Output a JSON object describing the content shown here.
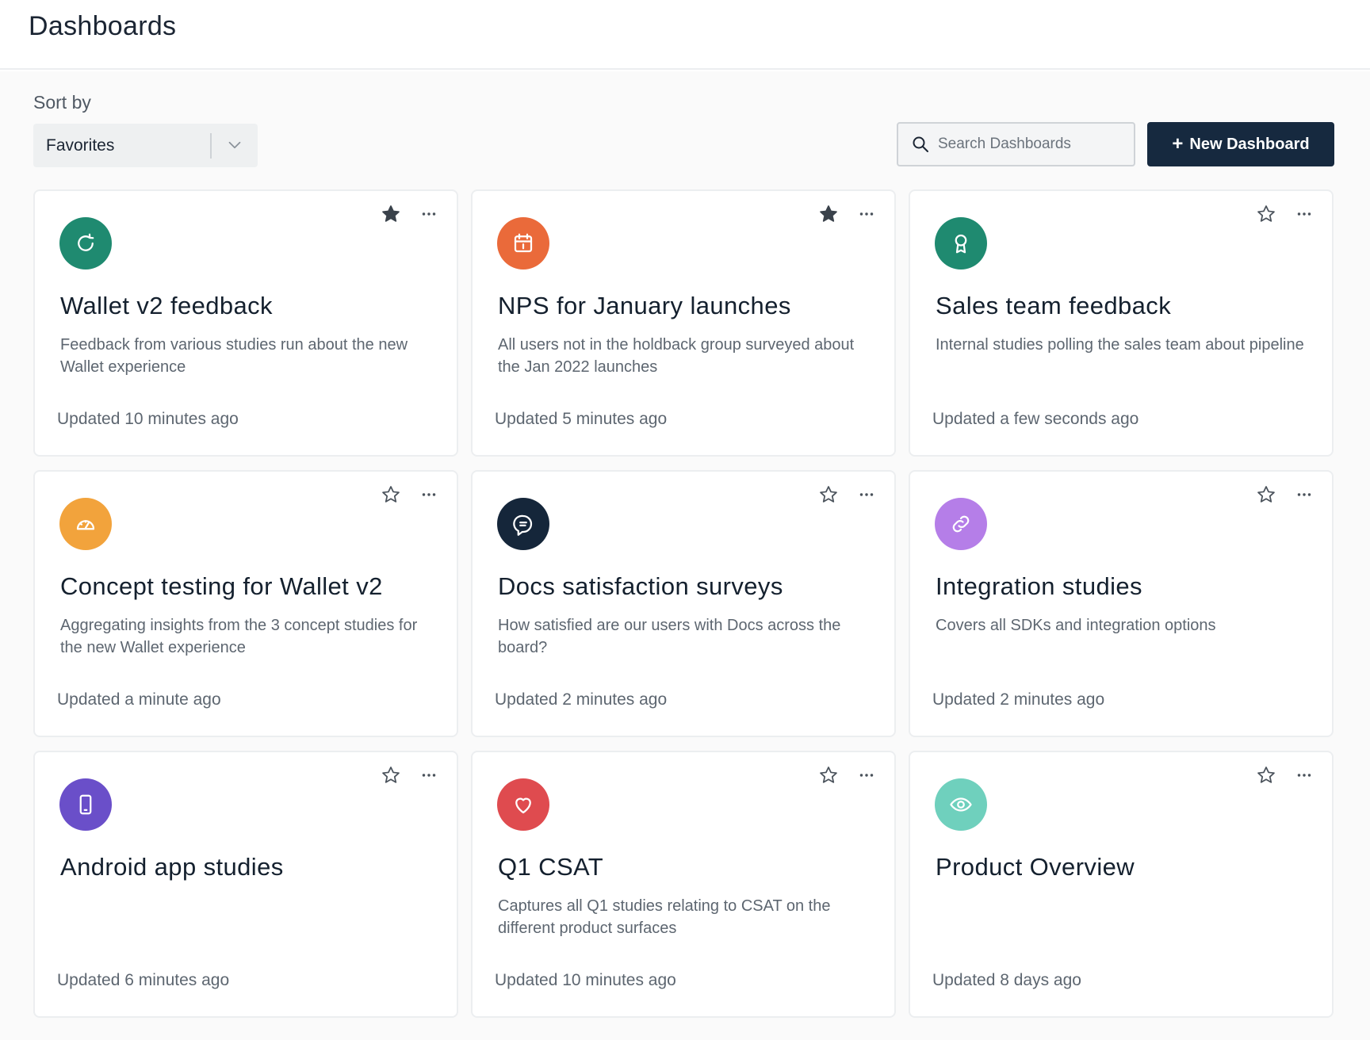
{
  "header": {
    "title": "Dashboards"
  },
  "toolbar": {
    "sort_label": "Sort by",
    "sort_value": "Favorites",
    "search_placeholder": "Search Dashboards",
    "new_dashboard_label": "New Dashboard",
    "new_dashboard_icon": "+"
  },
  "cards": [
    {
      "title": "Wallet v2 feedback",
      "description": "Feedback from various studies run about the new Wallet experience",
      "updated": "Updated 10 minutes ago",
      "favorited": true,
      "icon": "refresh-icon",
      "icon_color": "#1f8a70"
    },
    {
      "title": "NPS for January launches",
      "description": "All users not in the holdback group surveyed about the Jan 2022 launches",
      "updated": "Updated 5 minutes ago",
      "favorited": true,
      "icon": "calendar-icon",
      "icon_color": "#ea6a3a"
    },
    {
      "title": "Sales team feedback",
      "description": "Internal studies polling the sales team about pipeline",
      "updated": "Updated a few seconds ago",
      "favorited": false,
      "icon": "award-icon",
      "icon_color": "#1f8a70"
    },
    {
      "title": "Concept testing for Wallet v2",
      "description": "Aggregating insights from the 3 concept studies for the new Wallet experience",
      "updated": "Updated a minute ago",
      "favorited": false,
      "icon": "gauge-icon",
      "icon_color": "#f2a33c"
    },
    {
      "title": "Docs satisfaction surveys",
      "description": "How satisfied are our users with Docs across the board?",
      "updated": "Updated 2 minutes ago",
      "favorited": false,
      "icon": "chat-icon",
      "icon_color": "#15263a"
    },
    {
      "title": "Integration studies",
      "description": "Covers all SDKs and integration options",
      "updated": "Updated 2 minutes ago",
      "favorited": false,
      "icon": "link-icon",
      "icon_color": "#b57ee8"
    },
    {
      "title": "Android app studies",
      "description": "",
      "updated": "Updated 6 minutes ago",
      "favorited": false,
      "icon": "phone-icon",
      "icon_color": "#6a4fc9"
    },
    {
      "title": "Q1 CSAT",
      "description": "Captures all Q1 studies relating to CSAT on the different product surfaces",
      "updated": "Updated 10 minutes ago",
      "favorited": false,
      "icon": "heart-icon",
      "icon_color": "#df4b4f"
    },
    {
      "title": "Product Overview",
      "description": "",
      "updated": "Updated 8 days ago",
      "favorited": false,
      "icon": "eye-icon",
      "icon_color": "#6fd0bd"
    }
  ]
}
